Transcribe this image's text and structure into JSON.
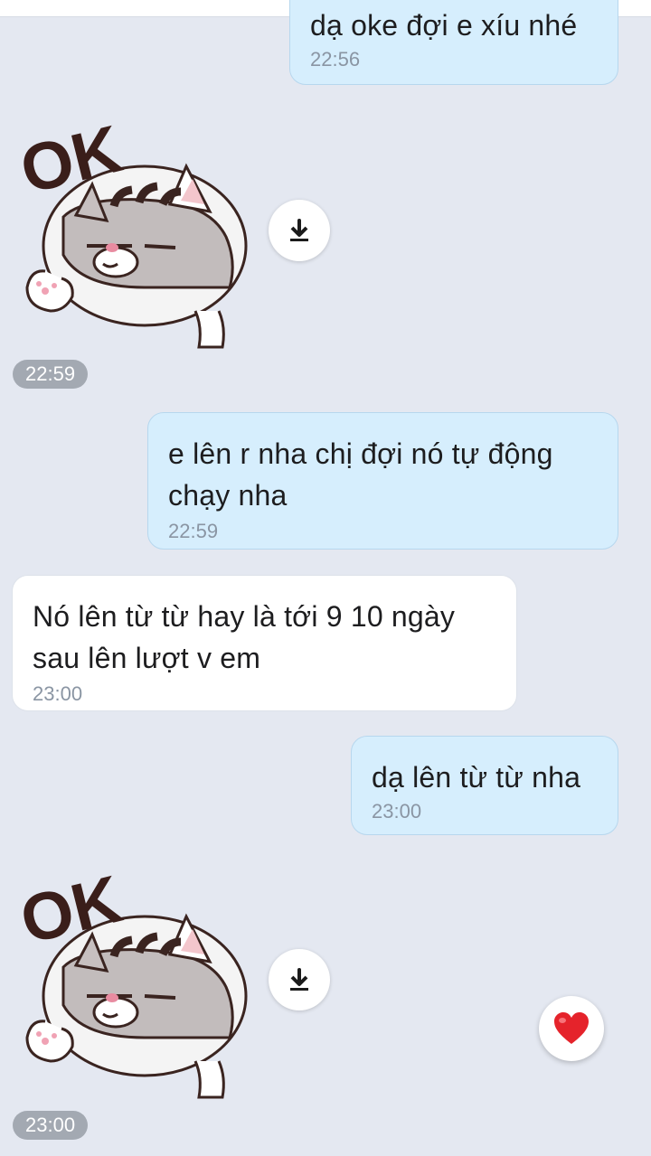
{
  "messages": [
    {
      "text": "dạ oke đợi e xíu nhé",
      "time": "22:56"
    },
    {
      "text": "e lên r nha chị đợi nó tự động chạy nha",
      "time": "22:59"
    },
    {
      "text": "Nó lên từ từ hay là tới 9 10 ngày sau lên lượt v em",
      "time": "23:00"
    },
    {
      "text": "dạ lên từ từ nha",
      "time": "23:00"
    }
  ],
  "stickers": [
    {
      "caption": "OK",
      "time": "22:59"
    },
    {
      "caption": "OK",
      "time": "23:00"
    }
  ],
  "icons": {
    "download": "download-icon",
    "reaction": "heart-icon"
  },
  "colors": {
    "background": "#e4e8f1",
    "outgoing_bubble": "#d6eefd",
    "incoming_bubble": "#ffffff",
    "timestamp": "#8a95a3",
    "heart": "#e5232b"
  }
}
